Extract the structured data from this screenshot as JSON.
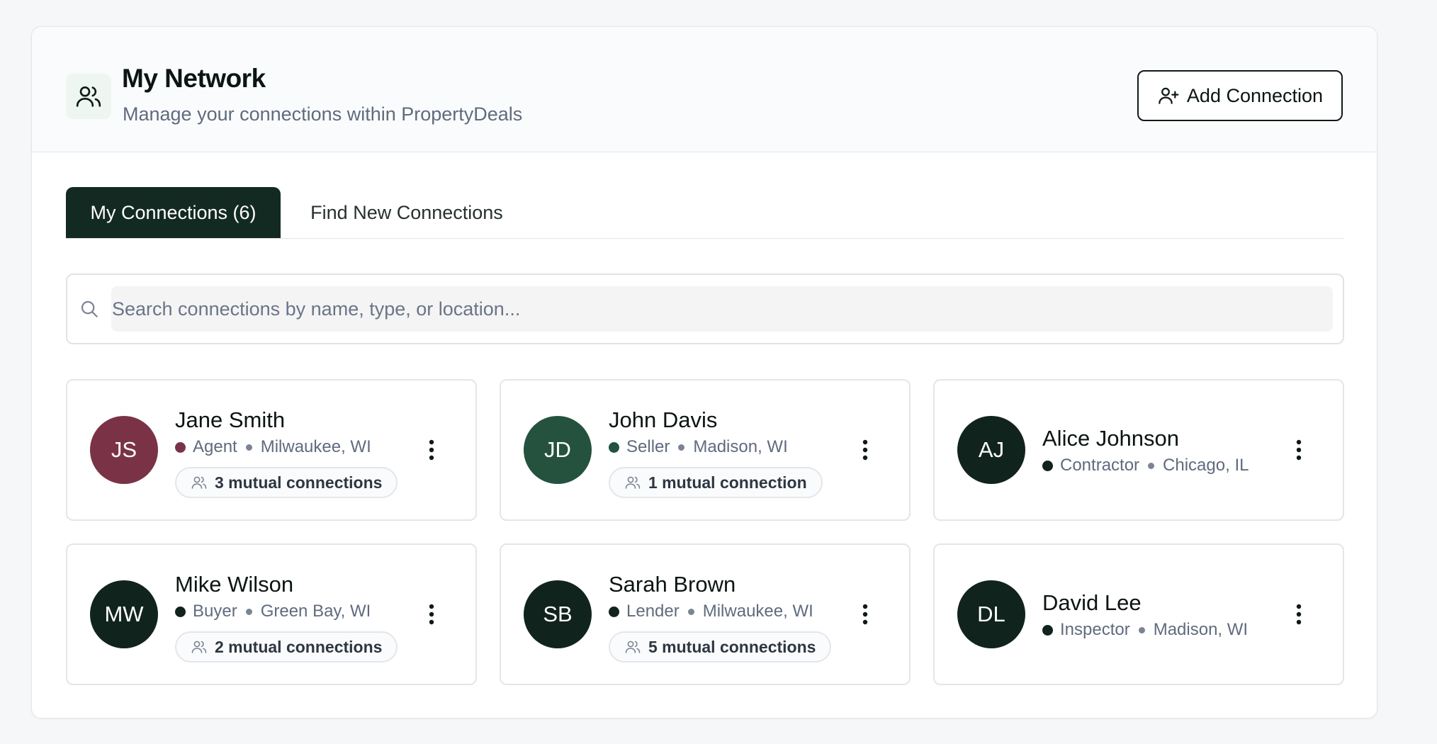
{
  "header": {
    "title": "My Network",
    "subtitle": "Manage your connections within PropertyDeals",
    "add_button_label": "Add Connection"
  },
  "tabs": [
    {
      "label": "My Connections (6)",
      "active": true
    },
    {
      "label": "Find New Connections",
      "active": false
    }
  ],
  "search": {
    "placeholder": "Search connections by name, type, or location...",
    "value": ""
  },
  "connections": [
    {
      "initials": "JS",
      "name": "Jane Smith",
      "type": "Agent",
      "location": "Milwaukee, WI",
      "mutual": "3 mutual connections",
      "avatar_color": "#7a3346",
      "dot_color": "#7a3346"
    },
    {
      "initials": "JD",
      "name": "John Davis",
      "type": "Seller",
      "location": "Madison, WI",
      "mutual": "1 mutual connection",
      "avatar_color": "#24523f",
      "dot_color": "#24523f"
    },
    {
      "initials": "AJ",
      "name": "Alice Johnson",
      "type": "Contractor",
      "location": "Chicago, IL",
      "mutual": "",
      "avatar_color": "#11231d",
      "dot_color": "#11231d"
    },
    {
      "initials": "MW",
      "name": "Mike Wilson",
      "type": "Buyer",
      "location": "Green Bay, WI",
      "mutual": "2 mutual connections",
      "avatar_color": "#11231d",
      "dot_color": "#11231d"
    },
    {
      "initials": "SB",
      "name": "Sarah Brown",
      "type": "Lender",
      "location": "Milwaukee, WI",
      "mutual": "5 mutual connections",
      "avatar_color": "#11231d",
      "dot_color": "#11231d"
    },
    {
      "initials": "DL",
      "name": "David Lee",
      "type": "Inspector",
      "location": "Madison, WI",
      "mutual": "",
      "avatar_color": "#11231d",
      "dot_color": "#11231d"
    }
  ]
}
